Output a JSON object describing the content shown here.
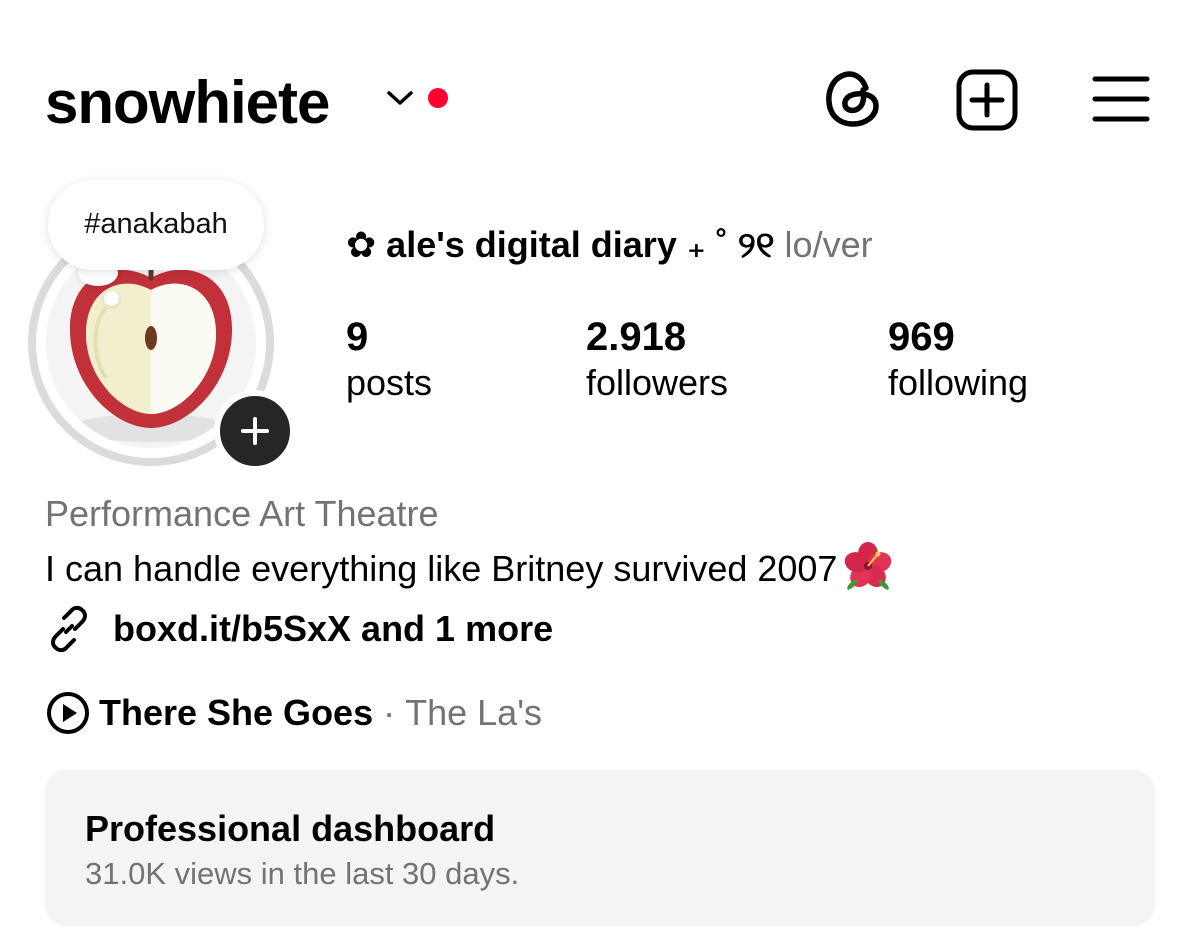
{
  "header": {
    "username": "snowhiete",
    "colors": {
      "notification_dot": "#ff0033",
      "text": "#000000"
    },
    "icons": [
      "chevron-down-icon",
      "threads-icon",
      "new-post-icon",
      "menu-icon"
    ]
  },
  "profile": {
    "note": "#anakabah",
    "display_name": "✿ ale's digital diary ₊ ˚ ୨୧",
    "pronouns": "lo/ver",
    "stats": {
      "posts": {
        "value": "9",
        "label": "posts"
      },
      "followers": {
        "value": "2.918",
        "label": "followers"
      },
      "following": {
        "value": "969",
        "label": "following"
      }
    },
    "category": "Performance Art Theatre",
    "bio": "I can handle everything like Britney survived 2007",
    "link": "boxd.it/b5SxX and 1 more",
    "music": {
      "title": "There She Goes",
      "separator": "·",
      "artist": "The La's"
    }
  },
  "dashboard": {
    "title": "Professional dashboard",
    "subtitle": "31.0K views in the last 30 days."
  }
}
